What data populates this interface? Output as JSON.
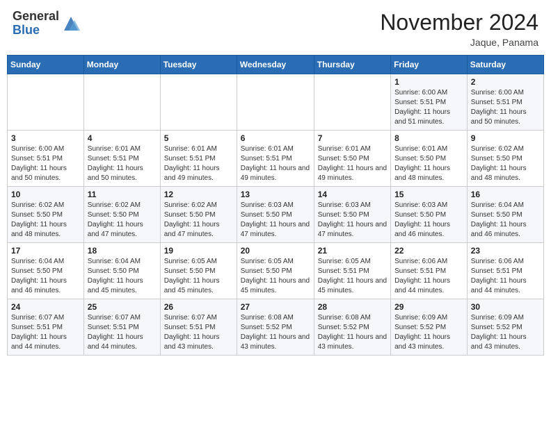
{
  "header": {
    "logo_general": "General",
    "logo_blue": "Blue",
    "month_title": "November 2024",
    "location": "Jaque, Panama"
  },
  "weekdays": [
    "Sunday",
    "Monday",
    "Tuesday",
    "Wednesday",
    "Thursday",
    "Friday",
    "Saturday"
  ],
  "weeks": [
    [
      {
        "day": "",
        "info": ""
      },
      {
        "day": "",
        "info": ""
      },
      {
        "day": "",
        "info": ""
      },
      {
        "day": "",
        "info": ""
      },
      {
        "day": "",
        "info": ""
      },
      {
        "day": "1",
        "info": "Sunrise: 6:00 AM\nSunset: 5:51 PM\nDaylight: 11 hours and 51 minutes."
      },
      {
        "day": "2",
        "info": "Sunrise: 6:00 AM\nSunset: 5:51 PM\nDaylight: 11 hours and 50 minutes."
      }
    ],
    [
      {
        "day": "3",
        "info": "Sunrise: 6:00 AM\nSunset: 5:51 PM\nDaylight: 11 hours and 50 minutes."
      },
      {
        "day": "4",
        "info": "Sunrise: 6:01 AM\nSunset: 5:51 PM\nDaylight: 11 hours and 50 minutes."
      },
      {
        "day": "5",
        "info": "Sunrise: 6:01 AM\nSunset: 5:51 PM\nDaylight: 11 hours and 49 minutes."
      },
      {
        "day": "6",
        "info": "Sunrise: 6:01 AM\nSunset: 5:51 PM\nDaylight: 11 hours and 49 minutes."
      },
      {
        "day": "7",
        "info": "Sunrise: 6:01 AM\nSunset: 5:50 PM\nDaylight: 11 hours and 49 minutes."
      },
      {
        "day": "8",
        "info": "Sunrise: 6:01 AM\nSunset: 5:50 PM\nDaylight: 11 hours and 48 minutes."
      },
      {
        "day": "9",
        "info": "Sunrise: 6:02 AM\nSunset: 5:50 PM\nDaylight: 11 hours and 48 minutes."
      }
    ],
    [
      {
        "day": "10",
        "info": "Sunrise: 6:02 AM\nSunset: 5:50 PM\nDaylight: 11 hours and 48 minutes."
      },
      {
        "day": "11",
        "info": "Sunrise: 6:02 AM\nSunset: 5:50 PM\nDaylight: 11 hours and 47 minutes."
      },
      {
        "day": "12",
        "info": "Sunrise: 6:02 AM\nSunset: 5:50 PM\nDaylight: 11 hours and 47 minutes."
      },
      {
        "day": "13",
        "info": "Sunrise: 6:03 AM\nSunset: 5:50 PM\nDaylight: 11 hours and 47 minutes."
      },
      {
        "day": "14",
        "info": "Sunrise: 6:03 AM\nSunset: 5:50 PM\nDaylight: 11 hours and 47 minutes."
      },
      {
        "day": "15",
        "info": "Sunrise: 6:03 AM\nSunset: 5:50 PM\nDaylight: 11 hours and 46 minutes."
      },
      {
        "day": "16",
        "info": "Sunrise: 6:04 AM\nSunset: 5:50 PM\nDaylight: 11 hours and 46 minutes."
      }
    ],
    [
      {
        "day": "17",
        "info": "Sunrise: 6:04 AM\nSunset: 5:50 PM\nDaylight: 11 hours and 46 minutes."
      },
      {
        "day": "18",
        "info": "Sunrise: 6:04 AM\nSunset: 5:50 PM\nDaylight: 11 hours and 45 minutes."
      },
      {
        "day": "19",
        "info": "Sunrise: 6:05 AM\nSunset: 5:50 PM\nDaylight: 11 hours and 45 minutes."
      },
      {
        "day": "20",
        "info": "Sunrise: 6:05 AM\nSunset: 5:50 PM\nDaylight: 11 hours and 45 minutes."
      },
      {
        "day": "21",
        "info": "Sunrise: 6:05 AM\nSunset: 5:51 PM\nDaylight: 11 hours and 45 minutes."
      },
      {
        "day": "22",
        "info": "Sunrise: 6:06 AM\nSunset: 5:51 PM\nDaylight: 11 hours and 44 minutes."
      },
      {
        "day": "23",
        "info": "Sunrise: 6:06 AM\nSunset: 5:51 PM\nDaylight: 11 hours and 44 minutes."
      }
    ],
    [
      {
        "day": "24",
        "info": "Sunrise: 6:07 AM\nSunset: 5:51 PM\nDaylight: 11 hours and 44 minutes."
      },
      {
        "day": "25",
        "info": "Sunrise: 6:07 AM\nSunset: 5:51 PM\nDaylight: 11 hours and 44 minutes."
      },
      {
        "day": "26",
        "info": "Sunrise: 6:07 AM\nSunset: 5:51 PM\nDaylight: 11 hours and 43 minutes."
      },
      {
        "day": "27",
        "info": "Sunrise: 6:08 AM\nSunset: 5:52 PM\nDaylight: 11 hours and 43 minutes."
      },
      {
        "day": "28",
        "info": "Sunrise: 6:08 AM\nSunset: 5:52 PM\nDaylight: 11 hours and 43 minutes."
      },
      {
        "day": "29",
        "info": "Sunrise: 6:09 AM\nSunset: 5:52 PM\nDaylight: 11 hours and 43 minutes."
      },
      {
        "day": "30",
        "info": "Sunrise: 6:09 AM\nSunset: 5:52 PM\nDaylight: 11 hours and 43 minutes."
      }
    ]
  ]
}
